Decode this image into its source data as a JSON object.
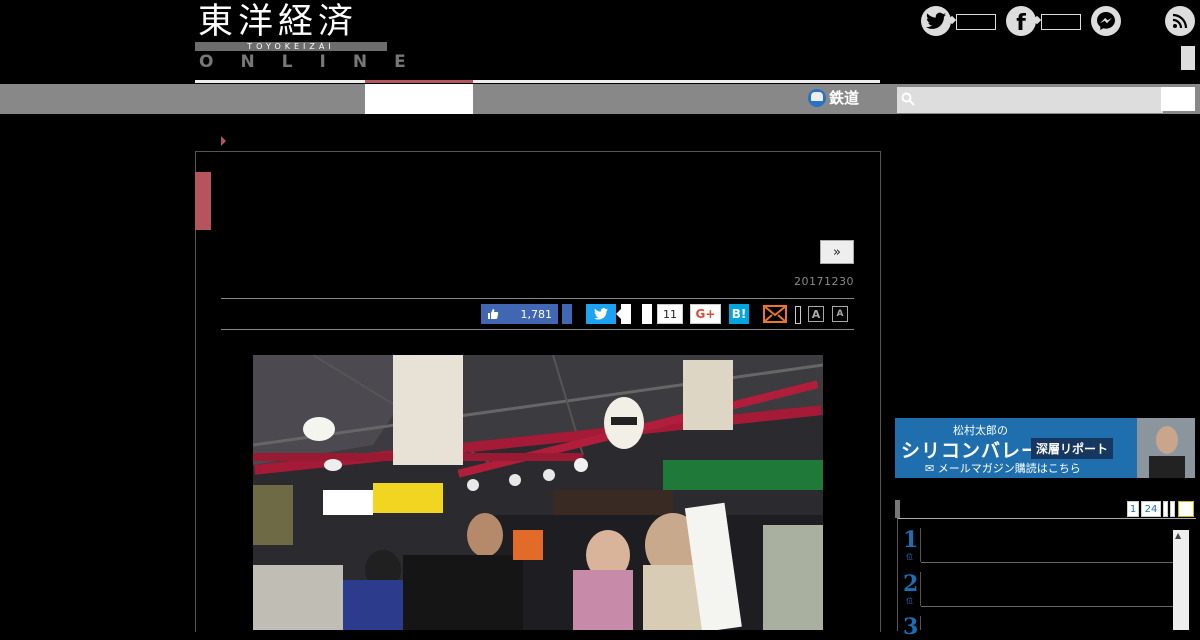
{
  "header": {
    "logo_kanji": "東洋経済",
    "logo_roman": "TOYOKEIZAI",
    "logo_online": "ONLINE"
  },
  "social": {
    "icons": [
      "twitter-icon",
      "facebook-icon",
      "messenger-icon",
      "rss-icon"
    ]
  },
  "nav": {
    "rail_label": "鉄道"
  },
  "search": {
    "placeholder": ""
  },
  "article": {
    "next_label": "»",
    "date": "20171230"
  },
  "share": {
    "like_count": "1,781",
    "hatena_count": "11",
    "gplus_label": "G+",
    "hatena_label": "B!",
    "font_large": "A",
    "font_small": "A"
  },
  "sidebar": {
    "banner": {
      "subtitle": "松村太郎の",
      "title": "シリコンバレー",
      "tag": "深層リポート",
      "mail_text": "メールマガジン購読はこちら"
    },
    "ranking": {
      "tabs": [
        "1",
        "24",
        "",
        "",
        ""
      ],
      "numbers": [
        "1",
        "2",
        "3"
      ],
      "num_suffix": "位"
    }
  },
  "colors": {
    "accent": "#b5545d",
    "nav": "#888888",
    "link_blue": "#1b6fb8"
  }
}
